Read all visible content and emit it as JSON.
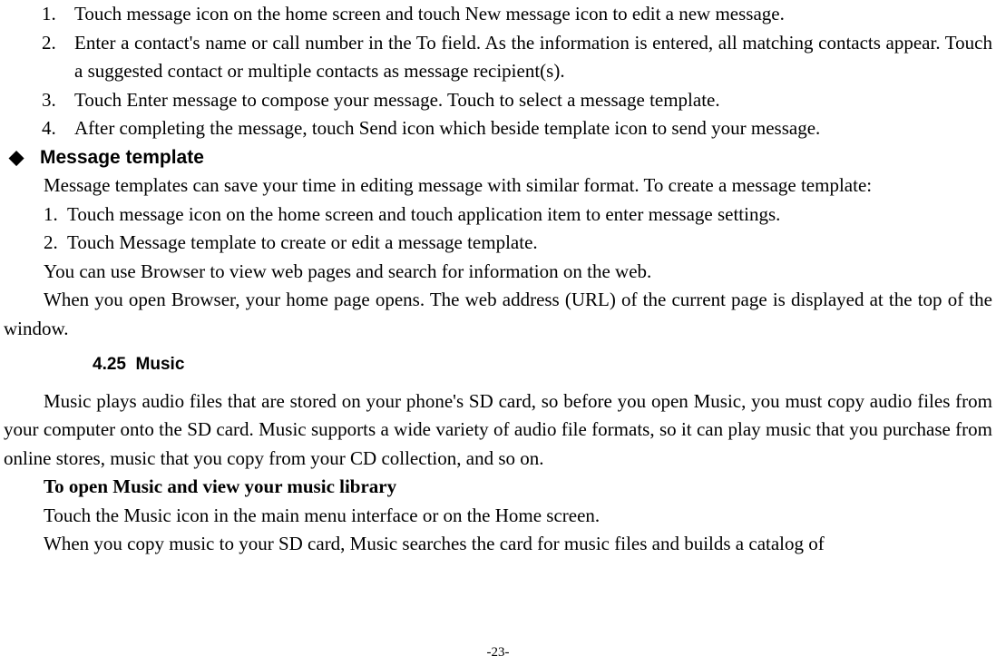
{
  "list1": [
    {
      "num": "1.",
      "text": "Touch message icon on the home screen and touch New message icon to edit a new message."
    },
    {
      "num": "2.",
      "text": "Enter a contact's name or call number in the To field. As the information is entered, all matching contacts appear. Touch a suggested contact or multiple contacts as message recipient(s)."
    },
    {
      "num": "3.",
      "text": "Touch Enter message to compose your message. Touch to select a message template."
    },
    {
      "num": "4.",
      "text": "After completing the message, touch Send icon which beside template icon to send your message."
    }
  ],
  "bullet": {
    "symbol": "◆",
    "label": "Message template"
  },
  "msg_template_intro": "Message templates can save your time in editing message with similar format. To create a message template:",
  "list2": [
    {
      "num": "1.",
      "text": "Touch message icon on the home screen and touch application item to enter message settings."
    },
    {
      "num": "2.",
      "text": "Touch Message template to create or edit a message template."
    }
  ],
  "browser_para1": "You can use Browser to view web pages and search for information on the web.",
  "browser_para2": "When you open Browser, your home page opens. The web address (URL) of the current page is displayed at the top of the window.",
  "heading": {
    "num": "4.25",
    "title": "Music"
  },
  "music_para": "Music plays audio files that are stored on your phone's SD card, so before you open Music, you must copy audio files from your computer onto the SD card. Music supports a wide variety of audio file formats, so it can play music that you purchase from online stores, music that you copy from your CD collection, and so on.",
  "music_subhead": "To open Music and view your music library",
  "music_line1": "Touch the Music icon in the main menu interface or on the Home screen.",
  "music_line2": "When you copy music to your SD card, Music searches the card for music files and builds a catalog of",
  "page_number": "-23-"
}
